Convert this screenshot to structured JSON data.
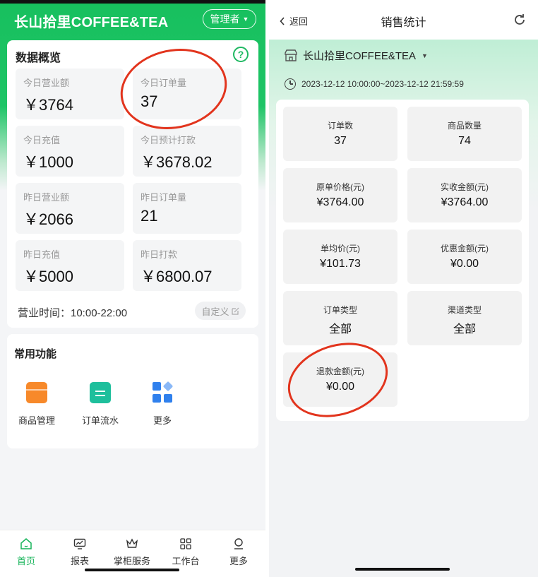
{
  "left": {
    "store_name": "长山拾里COFFEE&TEA",
    "role_button": "管理者",
    "overview": {
      "title": "数据概览",
      "help_icon": "question-circle-icon",
      "stats": [
        {
          "label": "今日营业额",
          "value": "￥3764"
        },
        {
          "label": "今日订单量",
          "value": "37"
        },
        {
          "label": "今日充值",
          "value": "￥1000"
        },
        {
          "label": "今日预计打款",
          "value": "￥3678.02"
        },
        {
          "label": "昨日营业额",
          "value": "￥2066"
        },
        {
          "label": "昨日订单量",
          "value": "21"
        },
        {
          "label": "昨日充值",
          "value": "￥5000"
        },
        {
          "label": "昨日打款",
          "value": "￥6800.07"
        }
      ],
      "business_hours": "营业时间：10:00-22:00",
      "custom_button": "自定义"
    },
    "functions": {
      "title": "常用功能",
      "items": [
        {
          "label": "商品管理",
          "icon": "wallet-icon"
        },
        {
          "label": "订单流水",
          "icon": "clipboard-icon"
        },
        {
          "label": "更多",
          "icon": "grid-icon"
        }
      ]
    },
    "tabs": [
      {
        "label": "首页",
        "icon": "home-icon",
        "active": true
      },
      {
        "label": "报表",
        "icon": "report-icon",
        "active": false
      },
      {
        "label": "掌柜服务",
        "icon": "crown-icon",
        "active": false
      },
      {
        "label": "工作台",
        "icon": "workbench-icon",
        "active": false
      },
      {
        "label": "更多",
        "icon": "profile-icon",
        "active": false
      }
    ],
    "accent_color": "#17c05e"
  },
  "right": {
    "back_label": "返回",
    "title": "销售统计",
    "store_name": "长山拾里COFFEE&TEA",
    "time_range": "2023-12-12 10:00:00~2023-12-12 21:59:59",
    "cells": [
      {
        "label": "订单数",
        "value": "37"
      },
      {
        "label": "商品数量",
        "value": "74"
      },
      {
        "label": "原单价格(元)",
        "value": "¥3764.00"
      },
      {
        "label": "实收金额(元)",
        "value": "¥3764.00"
      },
      {
        "label": "单均价(元)",
        "value": "¥101.73"
      },
      {
        "label": "优惠金额(元)",
        "value": "¥0.00"
      },
      {
        "label": "订单类型",
        "value": "全部"
      },
      {
        "label": "渠道类型",
        "value": "全部"
      },
      {
        "label": "退款金额(元)",
        "value": "¥0.00"
      }
    ]
  },
  "annotation_color": "#e2341d"
}
